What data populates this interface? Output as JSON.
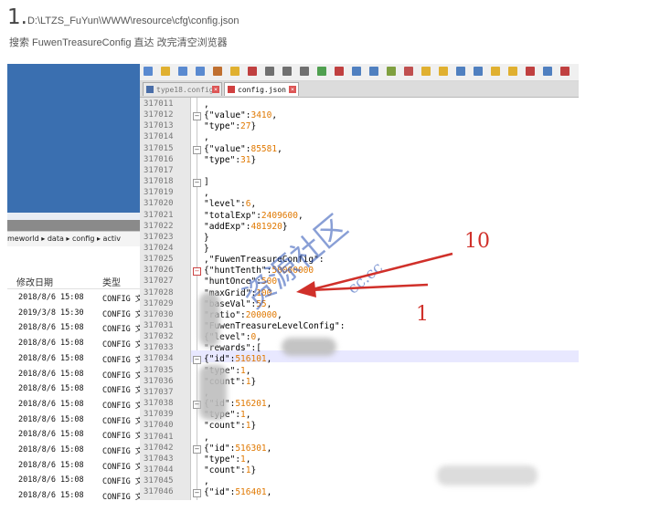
{
  "header": {
    "step_number": "1.",
    "path": "D:\\LTZS_FuYun\\WWW\\resource\\cfg\\config.json",
    "description": "搜索 FuwenTreasureConfig 直达 改完清空浏览器"
  },
  "explorer": {
    "address_bar": "meworld ▸ data ▸ config ▸ activ",
    "col_modified": "修改日期",
    "col_type": "类型",
    "rows": [
      {
        "date": "2018/8/6 15:08",
        "type": "CONFIG 文"
      },
      {
        "date": "2019/3/8 15:30",
        "type": "CONFIG 文"
      },
      {
        "date": "2018/8/6 15:08",
        "type": "CONFIG 文"
      },
      {
        "date": "2018/8/6 15:08",
        "type": "CONFIG 文"
      },
      {
        "date": "2018/8/6 15:08",
        "type": "CONFIG 文"
      },
      {
        "date": "2018/8/6 15:08",
        "type": "CONFIG 文"
      },
      {
        "date": "2018/8/6 15:08",
        "type": "CONFIG 文"
      },
      {
        "date": "2018/8/6 15:08",
        "type": "CONFIG 文"
      },
      {
        "date": "2018/8/6 15:08",
        "type": "CONFIG 文"
      },
      {
        "date": "2018/8/6 15:08",
        "type": "CONFIG 文"
      },
      {
        "date": "2018/8/6 15:08",
        "type": "CONFIG 文"
      },
      {
        "date": "2018/8/6 15:08",
        "type": "CONFIG 文"
      },
      {
        "date": "2018/8/6 15:08",
        "type": "CONFIG 文"
      },
      {
        "date": "2018/8/6 15:08",
        "type": "CONFIG 文"
      }
    ]
  },
  "editor": {
    "tabs": [
      {
        "label": "type18.config",
        "active": false
      },
      {
        "label": "config.json",
        "active": true
      }
    ],
    "line_numbers": [
      "317011",
      "317012",
      "317013",
      "317014",
      "317015",
      "317016",
      "317017",
      "317018",
      "317019",
      "317020",
      "317021",
      "317022",
      "317023",
      "317024",
      "317025",
      "317026",
      "317027",
      "317028",
      "317029",
      "317030",
      "317031",
      "317032",
      "317033",
      "317034",
      "317035",
      "317036",
      "317037",
      "317038",
      "317039",
      "317040",
      "317041",
      "317042",
      "317043",
      "317044",
      "317045",
      "317046"
    ],
    "code_lines": [
      ",",
      "{\"value\":3410,",
      "\"type\":27}",
      ",",
      "{\"value\":85581,",
      "\"type\":31}",
      "",
      "]",
      ",",
      "\"level\":6,",
      "\"totalExp\":2409600,",
      "\"addExp\":481920}",
      "}",
      "}",
      ",\"FuwenTreasureConfig\":",
      "{\"huntTenth\":50000000",
      "\"huntOnce\":500",
      "\"maxGrid\":100",
      "\"baseVal\":55,",
      "\"ratio\":200000,",
      "\"FuwenTreasureLevelConfig\":",
      "{\"level\":0,",
      "\"rewards\":[",
      "{\"id\":516101,",
      "\"type\":1,",
      "\"count\":1}",
      ",",
      "{\"id\":516201,",
      "\"type\":1,",
      "\"count\":1}",
      ",",
      "{\"id\":516301,",
      "\"type\":1,",
      "\"count\":1}",
      ",",
      "{\"id\":516401,"
    ]
  },
  "annotations": {
    "label_top": "10",
    "label_bottom": "1"
  },
  "watermark": {
    "main": "资源社区",
    "sub": "cc.cc"
  },
  "colors": {
    "annotation_red": "#d0302a",
    "number_orange": "#e07800",
    "explorer_blue": "#3a6fb0"
  }
}
